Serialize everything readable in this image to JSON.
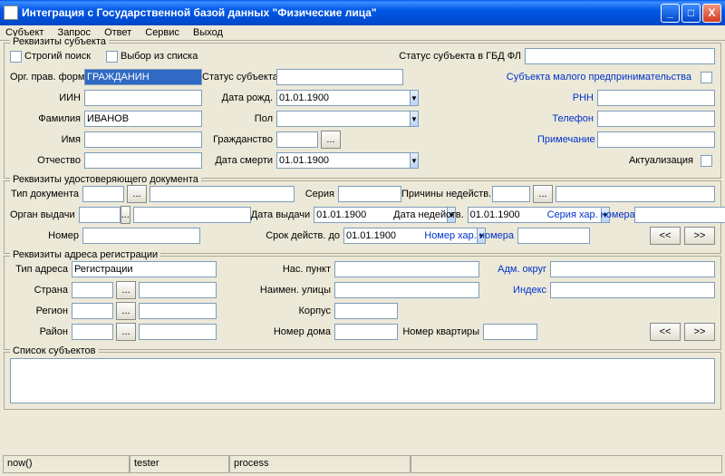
{
  "title": "Интеграция с Государственной базой данных \"Физические лица\"",
  "menu": {
    "subject": "Субъект",
    "request": "Запрос",
    "response": "Ответ",
    "service": "Сервис",
    "exit": "Выход"
  },
  "g1": {
    "legend": "Реквизиты субъекта",
    "strict": "Строгий поиск",
    "fromlist": "Выбор из списка",
    "status_gbd": "Статус субъекта в ГБД ФЛ",
    "orgform_l": "Орг. прав. форма",
    "orgform": "ГРАЖДАНИН",
    "status_l": "Статус субъекта",
    "smb": "Субъекта малого предпринимательства",
    "iin_l": "ИИН",
    "dob_l": "Дата рожд.",
    "dob": "01.01.1900",
    "rnn_l": "РНН",
    "fam_l": "Фамилия",
    "fam": "ИВАНОВ",
    "sex_l": "Пол",
    "tel_l": "Телефон",
    "name_l": "Имя",
    "cit_l": "Гражданство",
    "note_l": "Примечание",
    "patr_l": "Отчество",
    "dod_l": "Дата смерти",
    "dod": "01.01.1900",
    "act_l": "Актуализация"
  },
  "g2": {
    "legend": "Реквизиты удостоверяющего документа",
    "doctype_l": "Тип документа",
    "series_l": "Серия",
    "invalid_l": "Причины недейств.",
    "issuer_l": "Орган выдачи",
    "issued_l": "Дата выдачи",
    "issued": "01.01.1900",
    "invdate_l": "Дата недейств.",
    "invdate": "01.01.1900",
    "charser_l": "Серия хар. номера",
    "num_l": "Номер",
    "valid_l": "Срок действ. до",
    "valid": "01.01.1900",
    "charnum_l": "Номер хар. номера"
  },
  "g3": {
    "legend": "Реквизиты адреса регистрации",
    "atype_l": "Тип адреса",
    "atype": "Регистрации",
    "locality_l": "Нас. пункт",
    "adm_l": "Адм. округ",
    "country_l": "Страна",
    "street_l": "Наимен. улицы",
    "index_l": "Индекс",
    "region_l": "Регион",
    "block_l": "Корпус",
    "district_l": "Район",
    "house_l": "Номер дома",
    "apt_l": "Номер квартиры"
  },
  "g4": {
    "legend": "Список субъектов"
  },
  "status": {
    "c1": "now()",
    "c2": "tester",
    "c3": "process"
  },
  "nav": {
    "prev": "<<",
    "next": ">>"
  }
}
